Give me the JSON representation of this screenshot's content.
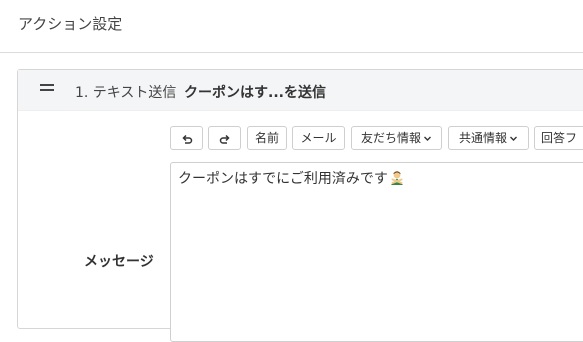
{
  "page": {
    "title": "アクション設定"
  },
  "action": {
    "label": "1. テキスト送信",
    "summary": "クーポンはす...を送信"
  },
  "toolbar": {
    "undo_icon": "undo-icon",
    "redo_icon": "redo-icon",
    "name_label": "名前",
    "mail_label": "メール",
    "friend_info_label": "友だち情報",
    "shared_info_label": "共通情報",
    "answer_form_label": "回答フ"
  },
  "message": {
    "label": "メッセージ",
    "text": "クーポンはすでにご利用済みです",
    "emoji_icon": "man-gesturing-no-icon"
  }
}
